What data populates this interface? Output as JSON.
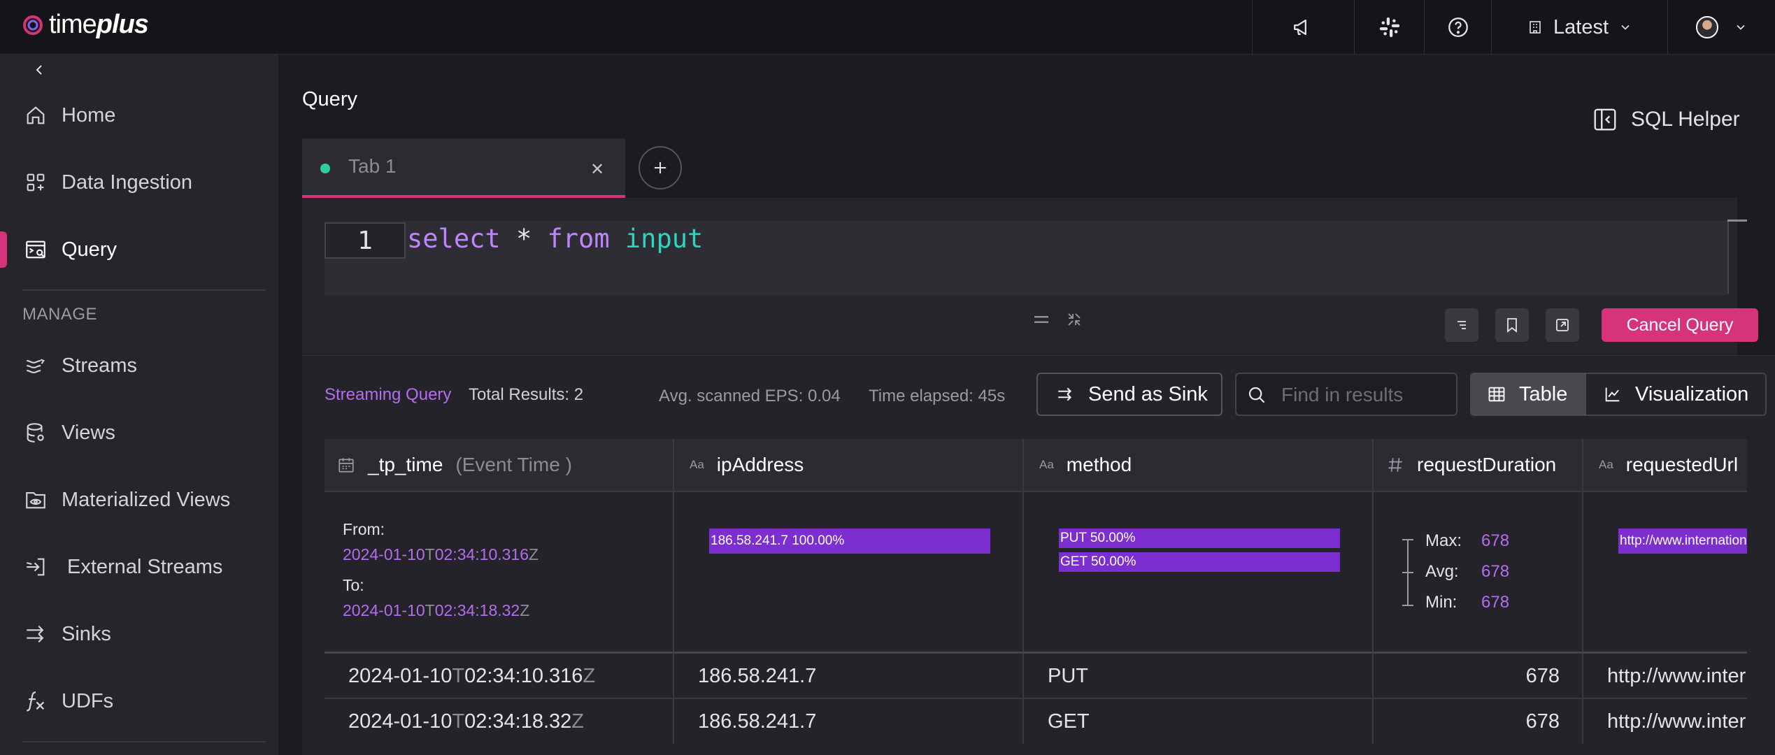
{
  "topbar": {
    "logo_prefix": "time",
    "logo_bold": "plus",
    "version_label": "Latest"
  },
  "sidebar": {
    "items": [
      {
        "label": "Home"
      },
      {
        "label": "Data Ingestion"
      },
      {
        "label": "Query"
      }
    ],
    "section_label": "MANAGE",
    "manage_items": [
      {
        "label": "Streams"
      },
      {
        "label": "Views"
      },
      {
        "label": "Materialized Views"
      },
      {
        "label": "External Streams"
      },
      {
        "label": "Sinks"
      },
      {
        "label": "UDFs"
      }
    ]
  },
  "main": {
    "title": "Query",
    "sql_helper_label": "SQL Helper",
    "tab_label": "Tab 1",
    "editor": {
      "line_number": "1",
      "kw_select": "select",
      "op_star": "*",
      "kw_from": "from",
      "stream_name": "input"
    },
    "cancel_label": "Cancel Query"
  },
  "results": {
    "mode_label": "Streaming Query",
    "total_label": "Total Results: 2",
    "eps_label": "Avg. scanned EPS: 0.04",
    "elapsed_label": "Time elapsed: 45s",
    "sink_label": "Send as Sink",
    "find_placeholder": "Find in results",
    "view_table_label": "Table",
    "view_vis_label": "Visualization"
  },
  "table": {
    "columns": [
      {
        "name": "_tp_time",
        "sub": "(Event Time )"
      },
      {
        "type_label": "Aa",
        "name": "ipAddress"
      },
      {
        "type_label": "Aa",
        "name": "method"
      },
      {
        "name": "requestDuration"
      },
      {
        "type_label": "Aa",
        "name": "requestedUrl"
      }
    ],
    "summary": {
      "from_label": "From:",
      "from_date": "2024-01-10",
      "from_t": "T",
      "from_time": "02:34:10.316",
      "from_z": "Z",
      "to_label": "To:",
      "to_date": "2024-01-10",
      "to_t": "T",
      "to_time": "02:34:18.32",
      "to_z": "Z",
      "ip_bar": "186.58.241.7 100.00%",
      "method_bar_1": "PUT 50.00%",
      "method_bar_2": "GET 50.00%",
      "max_label": "Max:",
      "max_val": "678",
      "avg_label": "Avg:",
      "avg_val": "678",
      "min_label": "Min:",
      "min_val": "678",
      "url_bar": "http://www.internationalcompany.com/"
    },
    "rows": [
      {
        "date": "2024-01-10",
        "t": "T",
        "time": "02:34:10.316",
        "z": "Z",
        "ip": "186.58.241.7",
        "method": "PUT",
        "duration": "678",
        "url": "http://www.internationalcompany.com/"
      },
      {
        "date": "2024-01-10",
        "t": "T",
        "time": "02:34:18.32",
        "z": "Z",
        "ip": "186.58.241.7",
        "method": "GET",
        "duration": "678",
        "url": "http://www.internationalcompany.com/"
      }
    ]
  },
  "colors": {
    "accent": "#d6337a",
    "purple": "#b46cf0",
    "bar": "#7c2ed0",
    "teal": "#2dd4bf",
    "live_dot": "#2bd19b"
  }
}
